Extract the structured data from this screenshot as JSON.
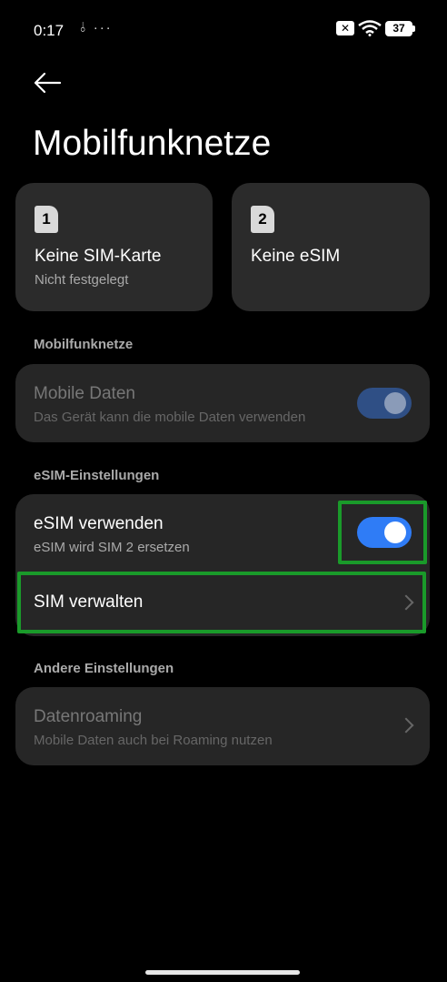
{
  "status_bar": {
    "time": "0:17",
    "left_icons": "⫰ ···",
    "sim_badge": "✕",
    "battery": "37"
  },
  "header": {
    "title": "Mobilfunknetze"
  },
  "sim_cards": [
    {
      "number": "1",
      "title": "Keine SIM-Karte",
      "subtitle": "Nicht festgelegt"
    },
    {
      "number": "2",
      "title": "Keine eSIM",
      "subtitle": ""
    }
  ],
  "mobile_section": {
    "header": "Mobilfunknetze",
    "mobile_data": {
      "title": "Mobile Daten",
      "subtitle": "Das Gerät kann die mobile Daten verwenden",
      "enabled": false
    }
  },
  "esim_section": {
    "header": "eSIM-Einstellungen",
    "use_esim": {
      "title": "eSIM verwenden",
      "subtitle": "eSIM wird SIM 2 ersetzen",
      "enabled": true
    },
    "manage_sim": {
      "title": "SIM verwalten"
    }
  },
  "other_section": {
    "header": "Andere Einstellungen",
    "roaming": {
      "title": "Datenroaming",
      "subtitle": "Mobile Daten auch bei Roaming nutzen"
    }
  },
  "colors": {
    "accent": "#2f7cf6",
    "highlight": "#1a9a2a",
    "card_bg": "#262626"
  }
}
